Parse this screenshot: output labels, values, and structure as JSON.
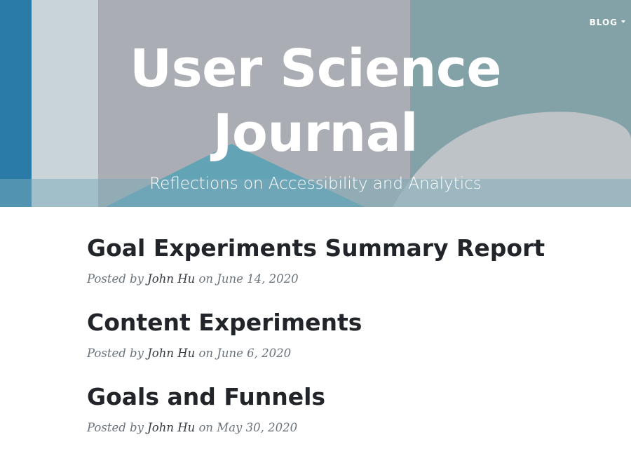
{
  "nav": {
    "blog_label": "BLOG"
  },
  "header": {
    "title_line1": "User Science",
    "title_line2": "Journal",
    "subtitle": "Reflections on Accessibility and Analytics"
  },
  "posts": [
    {
      "title": "Goal Experiments Summary Report",
      "posted_by": "Posted by",
      "author": "John Hu",
      "on": "on",
      "date": "June 14, 2020"
    },
    {
      "title": "Content Experiments",
      "posted_by": "Posted by",
      "author": "John Hu",
      "on": "on",
      "date": "June 6, 2020"
    },
    {
      "title": "Goals and Funnels",
      "posted_by": "Posted by",
      "author": "John Hu",
      "on": "on",
      "date": "May 30, 2020"
    }
  ],
  "colors": {
    "hero_overlay": "#8fb3bb",
    "heading": "#212529",
    "meta": "#6c757d"
  }
}
